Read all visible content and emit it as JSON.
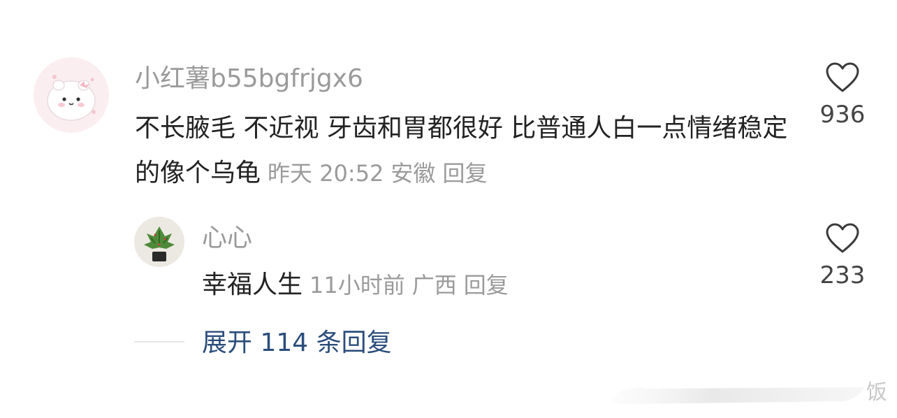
{
  "comment": {
    "username": "小红薯b55bgfrjgx6",
    "text": "不长腋毛 不近视 牙齿和胃都很好 比普通人白一点情绪稳定的像个乌龟",
    "time": "昨天 20:52",
    "location": "安徽",
    "reply_label": "回复",
    "like_count": "936"
  },
  "reply": {
    "username": "心心",
    "text": "幸福人生",
    "time": "11小时前",
    "location": "广西",
    "reply_label": "回复",
    "like_count": "233"
  },
  "expand_label": "展开 114 条回复",
  "watermark_text": "饭",
  "colors": {
    "meta": "#9a9a9a",
    "link": "#2b4d7c",
    "text": "#222222"
  },
  "icons": [
    "heart-outline-icon",
    "avatar-image"
  ]
}
